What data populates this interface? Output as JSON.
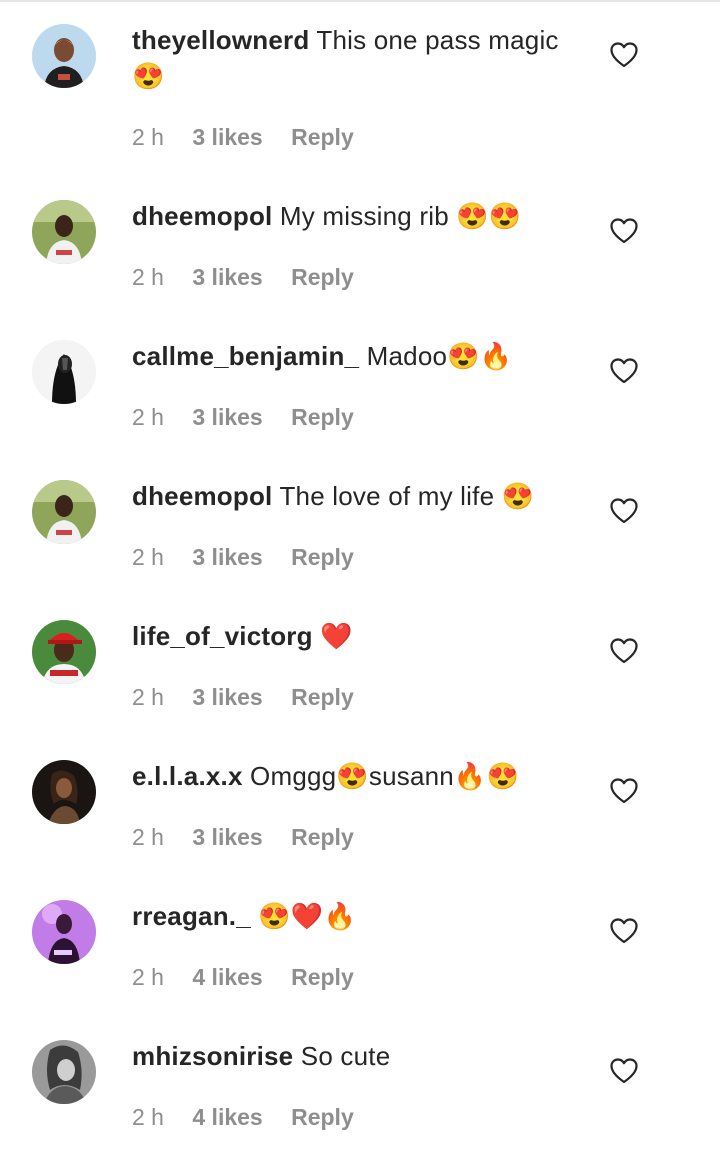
{
  "comments": [
    {
      "username": "theyellownerd",
      "text": "This one pass magic 😍",
      "time": "2 h",
      "likes": "3 likes",
      "reply": "Reply",
      "avatar": "avatar-light-blue-shirt"
    },
    {
      "username": "dheemopol",
      "text": "My missing rib 😍😍",
      "time": "2 h",
      "likes": "3 likes",
      "reply": "Reply",
      "avatar": "avatar-outdoor-green"
    },
    {
      "username": "callme_benjamin_",
      "text": "Madoo😍🔥",
      "time": "2 h",
      "likes": "3 likes",
      "reply": "Reply",
      "avatar": "avatar-black-white"
    },
    {
      "username": "dheemopol",
      "text": "The love of my life 😍",
      "time": "2 h",
      "likes": "3 likes",
      "reply": "Reply",
      "avatar": "avatar-outdoor-green"
    },
    {
      "username": "life_of_victorg",
      "text": "❤️",
      "time": "2 h",
      "likes": "3 likes",
      "reply": "Reply",
      "avatar": "avatar-red-cap"
    },
    {
      "username": "e.l.l.a.x.x",
      "text": "Omggg😍susann🔥😍",
      "time": "2 h",
      "likes": "3 likes",
      "reply": "Reply",
      "avatar": "avatar-dark-portrait"
    },
    {
      "username": "rreagan._",
      "text": "😍❤️🔥",
      "time": "2 h",
      "likes": "4 likes",
      "reply": "Reply",
      "avatar": "avatar-purple-neon"
    },
    {
      "username": "mhizsonirise",
      "text": "So cute",
      "time": "2 h",
      "likes": "4 likes",
      "reply": "Reply",
      "avatar": "avatar-grey-portrait"
    }
  ],
  "colors": {
    "text": "#262626",
    "meta": "#8e8e8e",
    "heart_outline": "#262626"
  },
  "icons": {
    "like": "heart-outline-icon"
  }
}
